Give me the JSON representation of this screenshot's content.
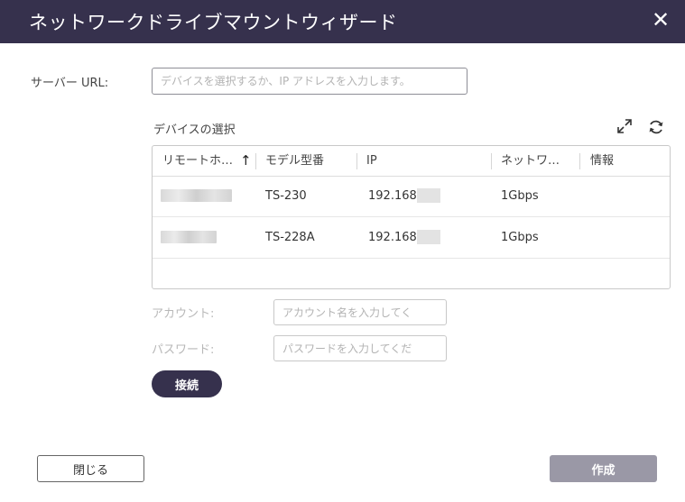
{
  "dialog": {
    "title": "ネットワークドライブマウントウィザード",
    "close_symbol": "✕"
  },
  "server_url": {
    "label": "サーバー URL:",
    "placeholder": "デバイスを選択するか、IP アドレスを入力します。",
    "value": ""
  },
  "device_select": {
    "title": "デバイスの選択",
    "icons": [
      "expand-icon",
      "refresh-icon"
    ],
    "columns": [
      {
        "label": "リモートホ…",
        "sort": "ascending",
        "sort_symbol": "↑"
      },
      {
        "label": "モデル型番"
      },
      {
        "label": "IP"
      },
      {
        "label": "ネットワ…"
      },
      {
        "label": "情報"
      }
    ],
    "rows": [
      {
        "model": "TS-230",
        "ip": "192.168.",
        "network": "1Gbps",
        "info": ""
      },
      {
        "model": "TS-228A",
        "ip": "192.168.",
        "network": "1Gbps",
        "info": ""
      }
    ]
  },
  "account": {
    "label": "アカウント:",
    "placeholder": "アカウント名を入力してく",
    "value": ""
  },
  "password": {
    "label": "パスワード:",
    "placeholder": "パスワードを入力してくだ",
    "value": ""
  },
  "buttons": {
    "connect": "接続",
    "close": "閉じる",
    "create": "作成"
  },
  "colors": {
    "title_bar": "#36314d",
    "primary_button": "#36314d",
    "disabled_button": "#9a98a6"
  }
}
